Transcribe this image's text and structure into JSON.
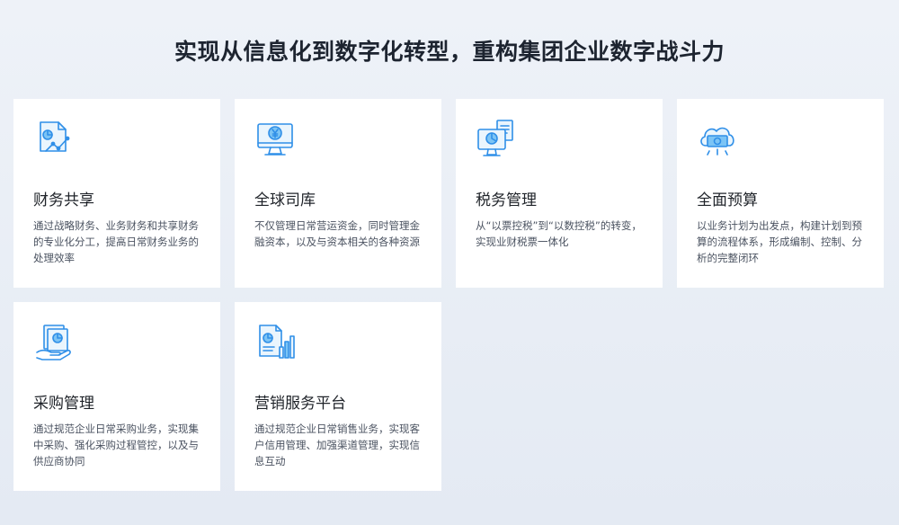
{
  "page": {
    "title": "实现从信息化到数字化转型，重构集团企业数字战斗力"
  },
  "colors": {
    "accent": "#2f8fe8",
    "accent_light": "#7cc4f5"
  },
  "cards": [
    {
      "icon": "document-chart-icon",
      "name": "财务共享",
      "desc": "通过战略财务、业务财务和共享财务的专业化分工，提高日常财务业务的处理效率"
    },
    {
      "icon": "monitor-yuan-icon",
      "name": "全球司库",
      "desc": "不仅管理日常营运资金，同时管理金融资本，以及与资本相关的各种资源"
    },
    {
      "icon": "monitor-document-icon",
      "name": "税务管理",
      "desc": "从“以票控税”到“以数控税”的转变，实现业财税票一体化"
    },
    {
      "icon": "cloud-money-icon",
      "name": "全面预算",
      "desc": "以业务计划为出发点，构建计划到预算的流程体系，形成编制、控制、分析的完整闭环"
    },
    {
      "icon": "hand-document-icon",
      "name": "采购管理",
      "desc": "通过规范企业日常采购业务，实现集中采购、强化采购过程管控，以及与供应商协同"
    },
    {
      "icon": "document-bar-chart-icon",
      "name": "营销服务平台",
      "desc": "通过规范企业日常销售业务，实现客户信用管理、加强渠道管理，实现信息互动"
    }
  ]
}
